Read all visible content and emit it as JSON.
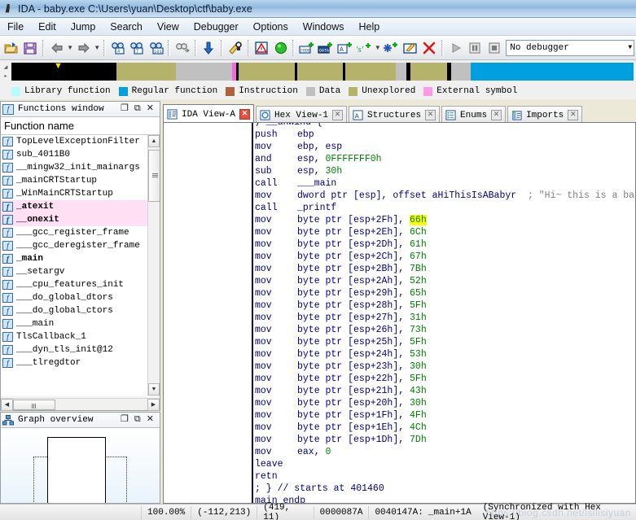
{
  "window": {
    "title": "IDA - baby.exe C:\\Users\\yuan\\Desktop\\ctf\\baby.exe",
    "icon": "ida-logo-icon"
  },
  "menu": {
    "items": [
      "File",
      "Edit",
      "Jump",
      "Search",
      "View",
      "Debugger",
      "Options",
      "Windows",
      "Help"
    ]
  },
  "toolbar": {
    "debugger_select_value": "No debugger",
    "buttons": [
      {
        "name": "open-file-icon",
        "glyph": "folder"
      },
      {
        "name": "save-file-icon",
        "glyph": "floppy"
      },
      {
        "name": "navigate-back-icon",
        "glyph": "arrow-left"
      },
      {
        "name": "navigate-back-dropdown-icon",
        "glyph": "caret"
      },
      {
        "name": "navigate-forward-icon",
        "glyph": "arrow-right"
      },
      {
        "name": "navigate-forward-dropdown-icon",
        "glyph": "caret"
      },
      {
        "name": "search-hex-icon",
        "glyph": "binoc-hash"
      },
      {
        "name": "search-text-icon",
        "glyph": "binoc-t"
      },
      {
        "name": "search-immediate-icon",
        "glyph": "binoc-101"
      },
      {
        "name": "search-next-icon",
        "glyph": "binoc-gray"
      },
      {
        "name": "jump-to-address-icon",
        "glyph": "blue-down-arrow"
      },
      {
        "name": "produce-file-icon",
        "glyph": "yellow-key"
      },
      {
        "name": "warning-icon",
        "glyph": "red-triangle"
      },
      {
        "name": "run-to-cursor-icon",
        "glyph": "green-circle"
      },
      {
        "name": "make-code-icon",
        "glyph": "code-plus"
      },
      {
        "name": "make-data-icon",
        "glyph": "data-plus"
      },
      {
        "name": "make-array-icon",
        "glyph": "array-plus"
      },
      {
        "name": "make-string-icon",
        "glyph": "string-plus"
      },
      {
        "name": "make-struct-icon",
        "glyph": "struct-plus"
      },
      {
        "name": "edit-function-icon",
        "glyph": "edit-pencil"
      },
      {
        "name": "undefine-icon",
        "glyph": "red-x"
      },
      {
        "name": "debugger-run-icon",
        "glyph": "play"
      },
      {
        "name": "debugger-pause-icon",
        "glyph": "pause"
      },
      {
        "name": "debugger-stop-icon",
        "glyph": "stop"
      }
    ]
  },
  "navband": {
    "marker_icon": "current-position-marker",
    "segments": [
      {
        "color": "#00a0e0",
        "width": 46.5
      },
      {
        "color": "#c0c0c0",
        "width": 5.5
      },
      {
        "color": "#000000",
        "width": 1.2
      },
      {
        "color": "#b5b36b",
        "width": 10.5
      },
      {
        "color": "#000000",
        "width": 1.2
      },
      {
        "color": "#c0c0c0",
        "width": 3.0
      },
      {
        "color": "#b5b36b",
        "width": 14.5
      },
      {
        "color": "#000000",
        "width": 0.7
      },
      {
        "color": "#b5b36b",
        "width": 13.0
      },
      {
        "color": "#000000",
        "width": 0.7
      },
      {
        "color": "#b5b36b",
        "width": 16.0
      },
      {
        "color": "#000000",
        "width": 0.7
      },
      {
        "color": "#ff66dd",
        "width": 1.2
      },
      {
        "color": "#c0c0c0",
        "width": 16.0
      },
      {
        "color": "#b5b36b",
        "width": 17.0
      },
      {
        "color": "#000000",
        "width": 30.0
      }
    ]
  },
  "legend": {
    "items": [
      {
        "label": "Library function",
        "color": "#b6fbff"
      },
      {
        "label": "Regular function",
        "color": "#00a0e0"
      },
      {
        "label": "Instruction",
        "color": "#b0603a"
      },
      {
        "label": "Data",
        "color": "#c0c0c0"
      },
      {
        "label": "Unexplored",
        "color": "#b5b36b"
      },
      {
        "label": "External symbol",
        "color": "#ff9ae8"
      }
    ]
  },
  "functions_panel": {
    "title": "Functions window",
    "title_icon": "function-window-icon",
    "buttons": [
      "maximize-icon",
      "restore-icon",
      "close-icon"
    ],
    "column_header": "Function name",
    "items": [
      {
        "name": "TopLevelExceptionFilter",
        "selected": false,
        "bold": false
      },
      {
        "name": "sub_4011B0",
        "selected": false,
        "bold": false
      },
      {
        "name": "__mingw32_init_mainargs",
        "selected": false,
        "bold": false
      },
      {
        "name": "_mainCRTStartup",
        "selected": false,
        "bold": false
      },
      {
        "name": "_WinMainCRTStartup",
        "selected": false,
        "bold": false
      },
      {
        "name": "_atexit",
        "selected": true,
        "bold": true
      },
      {
        "name": "__onexit",
        "selected": true,
        "bold": true
      },
      {
        "name": "___gcc_register_frame",
        "selected": false,
        "bold": false
      },
      {
        "name": "___gcc_deregister_frame",
        "selected": false,
        "bold": false
      },
      {
        "name": "_main",
        "selected": false,
        "bold": true
      },
      {
        "name": "__setargv",
        "selected": false,
        "bold": false
      },
      {
        "name": "___cpu_features_init",
        "selected": false,
        "bold": false
      },
      {
        "name": "___do_global_dtors",
        "selected": false,
        "bold": false
      },
      {
        "name": "___do_global_ctors",
        "selected": false,
        "bold": false
      },
      {
        "name": "___main",
        "selected": false,
        "bold": false
      },
      {
        "name": "TlsCallback_1",
        "selected": false,
        "bold": false
      },
      {
        "name": "___dyn_tls_init@12",
        "selected": false,
        "bold": false
      },
      {
        "name": "___tlregdtor",
        "selected": false,
        "bold": false
      }
    ]
  },
  "graph_overview": {
    "title": "Graph overview",
    "title_icon": "graph-overview-icon",
    "buttons": [
      "maximize-icon",
      "restore-icon",
      "close-icon"
    ]
  },
  "tabs": [
    {
      "label": "IDA View-A",
      "icon": "ida-view-icon",
      "active": true
    },
    {
      "label": "Hex View-1",
      "icon": "hex-view-icon",
      "active": false
    },
    {
      "label": "Structures",
      "icon": "structures-icon",
      "active": false
    },
    {
      "label": "Enums",
      "icon": "enums-icon",
      "active": false
    },
    {
      "label": "Imports",
      "icon": "imports-icon",
      "active": false
    }
  ],
  "disassembly": {
    "lines": [
      {
        "kind": "cut",
        "text": "; __unwind {"
      },
      {
        "kind": "ins",
        "mnemonic": "push",
        "operand": "ebp"
      },
      {
        "kind": "ins",
        "mnemonic": "mov",
        "operand": "ebp, esp"
      },
      {
        "kind": "ins",
        "mnemonic": "and",
        "operand": "esp, ",
        "num": "0FFFFFFF0h"
      },
      {
        "kind": "ins",
        "mnemonic": "sub",
        "operand": "esp, ",
        "num": "30h"
      },
      {
        "kind": "ins",
        "mnemonic": "call",
        "operand": "___main"
      },
      {
        "kind": "ins",
        "mnemonic": "mov",
        "operand": "dword ptr [esp], offset aHiThisIsABabyr",
        "comment": "; \"Hi~ this is a ba"
      },
      {
        "kind": "ins",
        "mnemonic": "call",
        "operand": "_printf"
      },
      {
        "kind": "ins",
        "mnemonic": "mov",
        "operand": "byte ptr [esp+2Fh], ",
        "num": "66h",
        "highlight": true
      },
      {
        "kind": "ins",
        "mnemonic": "mov",
        "operand": "byte ptr [esp+2Eh], ",
        "num": "6Ch"
      },
      {
        "kind": "ins",
        "mnemonic": "mov",
        "operand": "byte ptr [esp+2Dh], ",
        "num": "61h"
      },
      {
        "kind": "ins",
        "mnemonic": "mov",
        "operand": "byte ptr [esp+2Ch], ",
        "num": "67h"
      },
      {
        "kind": "ins",
        "mnemonic": "mov",
        "operand": "byte ptr [esp+2Bh], ",
        "num": "7Bh"
      },
      {
        "kind": "ins",
        "mnemonic": "mov",
        "operand": "byte ptr [esp+2Ah], ",
        "num": "52h"
      },
      {
        "kind": "ins",
        "mnemonic": "mov",
        "operand": "byte ptr [esp+29h], ",
        "num": "65h"
      },
      {
        "kind": "ins",
        "mnemonic": "mov",
        "operand": "byte ptr [esp+28h], ",
        "num": "5Fh"
      },
      {
        "kind": "ins",
        "mnemonic": "mov",
        "operand": "byte ptr [esp+27h], ",
        "num": "31h"
      },
      {
        "kind": "ins",
        "mnemonic": "mov",
        "operand": "byte ptr [esp+26h], ",
        "num": "73h"
      },
      {
        "kind": "ins",
        "mnemonic": "mov",
        "operand": "byte ptr [esp+25h], ",
        "num": "5Fh"
      },
      {
        "kind": "ins",
        "mnemonic": "mov",
        "operand": "byte ptr [esp+24h], ",
        "num": "53h"
      },
      {
        "kind": "ins",
        "mnemonic": "mov",
        "operand": "byte ptr [esp+23h], ",
        "num": "30h"
      },
      {
        "kind": "ins",
        "mnemonic": "mov",
        "operand": "byte ptr [esp+22h], ",
        "num": "5Fh"
      },
      {
        "kind": "ins",
        "mnemonic": "mov",
        "operand": "byte ptr [esp+21h], ",
        "num": "43h"
      },
      {
        "kind": "ins",
        "mnemonic": "mov",
        "operand": "byte ptr [esp+20h], ",
        "num": "30h"
      },
      {
        "kind": "ins",
        "mnemonic": "mov",
        "operand": "byte ptr [esp+1Fh], ",
        "num": "4Fh"
      },
      {
        "kind": "ins",
        "mnemonic": "mov",
        "operand": "byte ptr [esp+1Eh], ",
        "num": "4Ch"
      },
      {
        "kind": "ins",
        "mnemonic": "mov",
        "operand": "byte ptr [esp+1Dh], ",
        "num": "7Dh"
      },
      {
        "kind": "ins",
        "mnemonic": "mov",
        "operand": "eax, ",
        "num": "0"
      },
      {
        "kind": "ins",
        "mnemonic": "leave",
        "operand": ""
      },
      {
        "kind": "ins",
        "mnemonic": "retn",
        "operand": ""
      },
      {
        "kind": "cmt",
        "text": "; } // starts at 401460"
      },
      {
        "kind": "cut2",
        "text": "main endp"
      }
    ]
  },
  "statusbar": {
    "zoom": "100.00%",
    "delta": "(-112,213)",
    "coords": "(419, 11)",
    "file_offset": "0000087A",
    "address": "0040147A:",
    "location": "_main+1A",
    "sync": "(Synchronized with Hex View-1)",
    "watermark": "https://blog.csdn.net/lsllisiyuan"
  }
}
